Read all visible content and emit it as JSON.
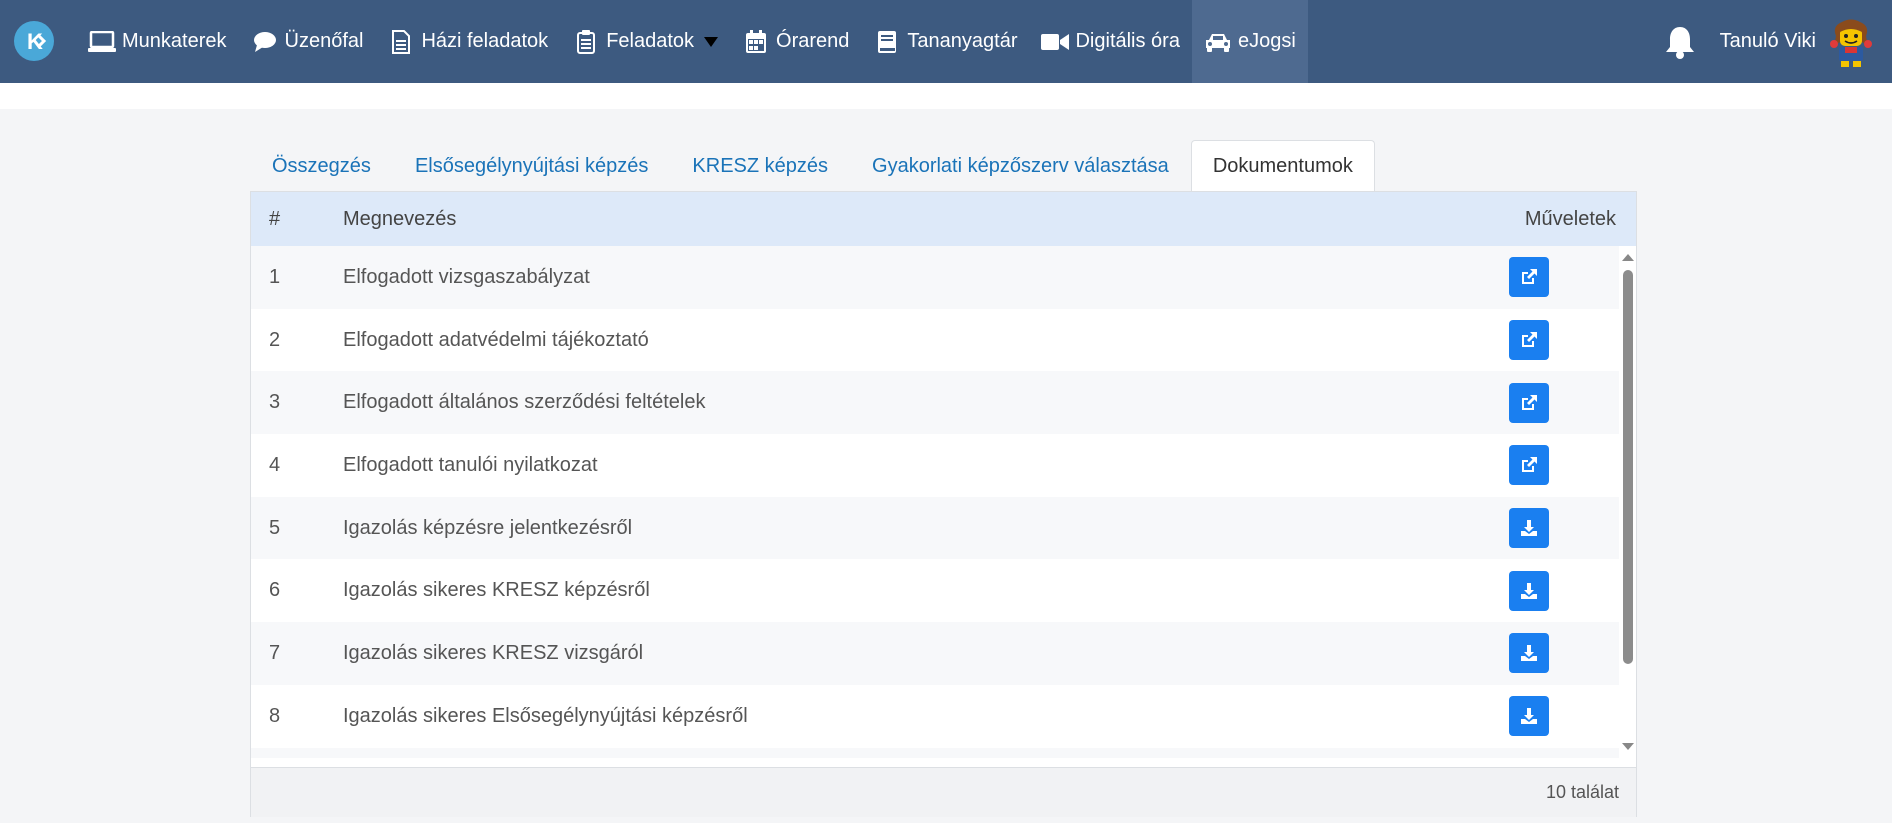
{
  "nav": {
    "items": [
      {
        "label": "Munkaterek",
        "icon": "laptop-icon"
      },
      {
        "label": "Üzenőfal",
        "icon": "comment-icon"
      },
      {
        "label": "Házi feladatok",
        "icon": "file-icon"
      },
      {
        "label": "Feladatok",
        "icon": "clipboard-icon"
      },
      {
        "label": "Órarend",
        "icon": "calendar-icon"
      },
      {
        "label": "Tananyagtár",
        "icon": "book-icon"
      },
      {
        "label": "Digitális óra",
        "icon": "video-icon"
      },
      {
        "label": "eJogsi",
        "icon": "car-icon"
      }
    ],
    "user_name": "Tanuló Viki"
  },
  "tabs": [
    {
      "label": "Összegzés"
    },
    {
      "label": "Elsősegélynyújtási képzés"
    },
    {
      "label": "KRESZ képzés"
    },
    {
      "label": "Gyakorlati képzőszerv választása"
    },
    {
      "label": "Dokumentumok"
    }
  ],
  "table": {
    "headers": {
      "num": "#",
      "name": "Megnevezés",
      "actions": "Műveletek"
    },
    "rows": [
      {
        "num": "1",
        "name": "Elfogadott vizsgaszabályzat",
        "action": "external-link-icon"
      },
      {
        "num": "2",
        "name": "Elfogadott adatvédelmi tájékoztató",
        "action": "external-link-icon"
      },
      {
        "num": "3",
        "name": "Elfogadott általános szerződési feltételek",
        "action": "external-link-icon"
      },
      {
        "num": "4",
        "name": "Elfogadott tanulói nyilatkozat",
        "action": "external-link-icon"
      },
      {
        "num": "5",
        "name": "Igazolás képzésre jelentkezésről",
        "action": "download-icon"
      },
      {
        "num": "6",
        "name": "Igazolás sikeres KRESZ képzésről",
        "action": "download-icon"
      },
      {
        "num": "7",
        "name": "Igazolás sikeres KRESZ vizsgáról",
        "action": "download-icon"
      },
      {
        "num": "8",
        "name": "Igazolás sikeres Elsősegélynyújtási képzésről",
        "action": "download-icon"
      }
    ],
    "footer": "10 találat"
  },
  "colors": {
    "navbar": "#3d5a80",
    "accent": "#1a7ff0",
    "header_row": "#dde9f9",
    "tab_link": "#1a73b8"
  }
}
